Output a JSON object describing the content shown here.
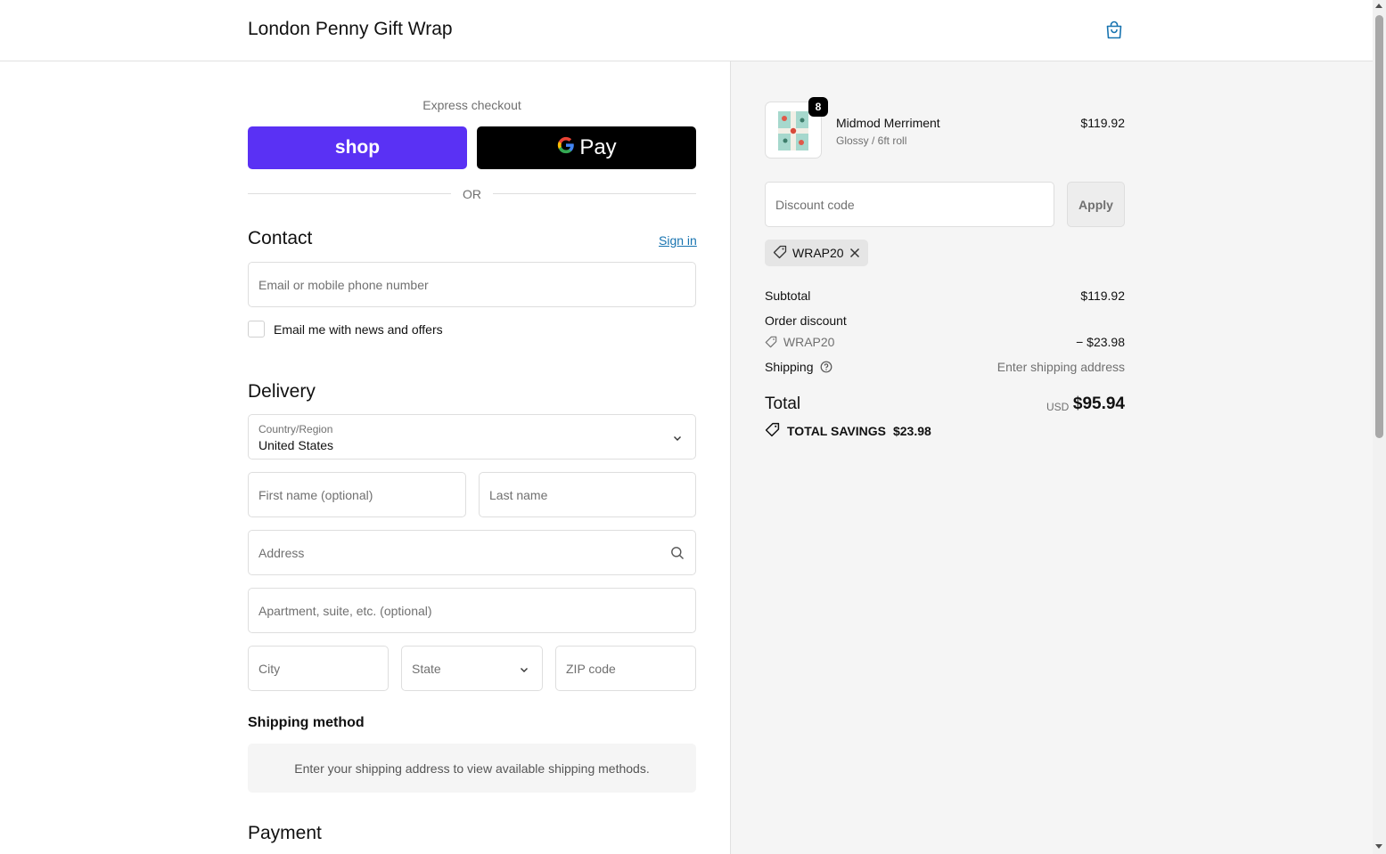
{
  "header": {
    "store_name": "London Penny Gift Wrap",
    "cart_icon": "shopping-bag-icon",
    "accent": "#1773b0"
  },
  "express": {
    "label": "Express checkout",
    "shop_label": "shop",
    "gpay_label": "Pay",
    "or": "OR",
    "shop_color": "#5a31f4"
  },
  "contact": {
    "title": "Contact",
    "sign_in": "Sign in",
    "email_placeholder": "Email or mobile phone number",
    "news_label": "Email me with news and offers"
  },
  "delivery": {
    "title": "Delivery",
    "country_label": "Country/Region",
    "country_value": "United States",
    "first_name_placeholder": "First name (optional)",
    "last_name_placeholder": "Last name",
    "address_placeholder": "Address",
    "apartment_placeholder": "Apartment, suite, etc. (optional)",
    "city_placeholder": "City",
    "state_placeholder": "State",
    "zip_placeholder": "ZIP code"
  },
  "shipping_method": {
    "title": "Shipping method",
    "message": "Enter your shipping address to view available shipping methods."
  },
  "payment": {
    "title": "Payment"
  },
  "order": {
    "item": {
      "name": "Midmod Merriment",
      "variant": "Glossy / 6ft roll",
      "price": "$119.92",
      "quantity": "8"
    },
    "discount_placeholder": "Discount code",
    "apply_label": "Apply",
    "applied_code": "WRAP20",
    "subtotal_label": "Subtotal",
    "subtotal_value": "$119.92",
    "order_discount_label": "Order discount",
    "discount_code": "WRAP20",
    "discount_value": "− $23.98",
    "shipping_label": "Shipping",
    "shipping_value": "Enter shipping address",
    "total_label": "Total",
    "total_currency": "USD",
    "total_value": "$95.94",
    "savings_label": "TOTAL SAVINGS",
    "savings_value": "$23.98"
  }
}
